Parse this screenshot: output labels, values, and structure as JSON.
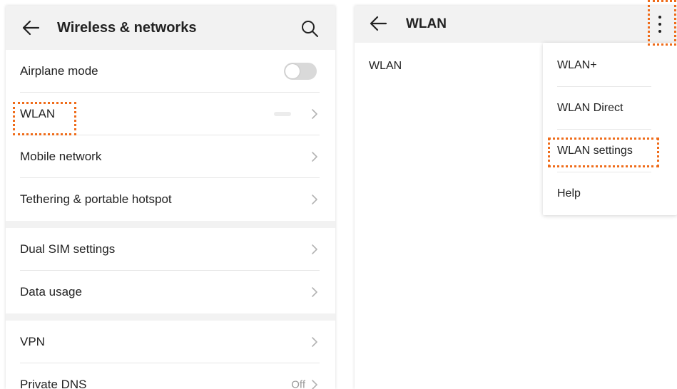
{
  "left": {
    "title": "Wireless & networks",
    "icons": {
      "back": "back-arrow-icon",
      "search": "search-icon"
    },
    "groups": [
      {
        "items": [
          {
            "label": "Airplane mode",
            "control": "toggle",
            "toggle_on": false
          },
          {
            "label": "WLAN",
            "control": "chevron",
            "highlighted": true
          },
          {
            "label": "Mobile network",
            "control": "chevron"
          },
          {
            "label": "Tethering & portable hotspot",
            "control": "chevron"
          }
        ]
      },
      {
        "items": [
          {
            "label": "Dual SIM settings",
            "control": "chevron"
          },
          {
            "label": "Data usage",
            "control": "chevron"
          }
        ]
      },
      {
        "items": [
          {
            "label": "VPN",
            "control": "chevron"
          },
          {
            "label": "Private DNS",
            "control": "chevron",
            "value": "Off"
          }
        ]
      }
    ]
  },
  "right": {
    "title": "WLAN",
    "body_label": "WLAN",
    "icons": {
      "back": "back-arrow-icon",
      "more": "more-vertical-icon"
    },
    "menu": [
      {
        "label": "WLAN+"
      },
      {
        "label": "WLAN Direct"
      },
      {
        "label": "WLAN settings",
        "highlighted": true
      },
      {
        "label": "Help"
      }
    ]
  },
  "colors": {
    "highlight": "#ef6c1a",
    "header_bg": "#f2f2f2",
    "toggle_off": "#d9d9d9"
  }
}
